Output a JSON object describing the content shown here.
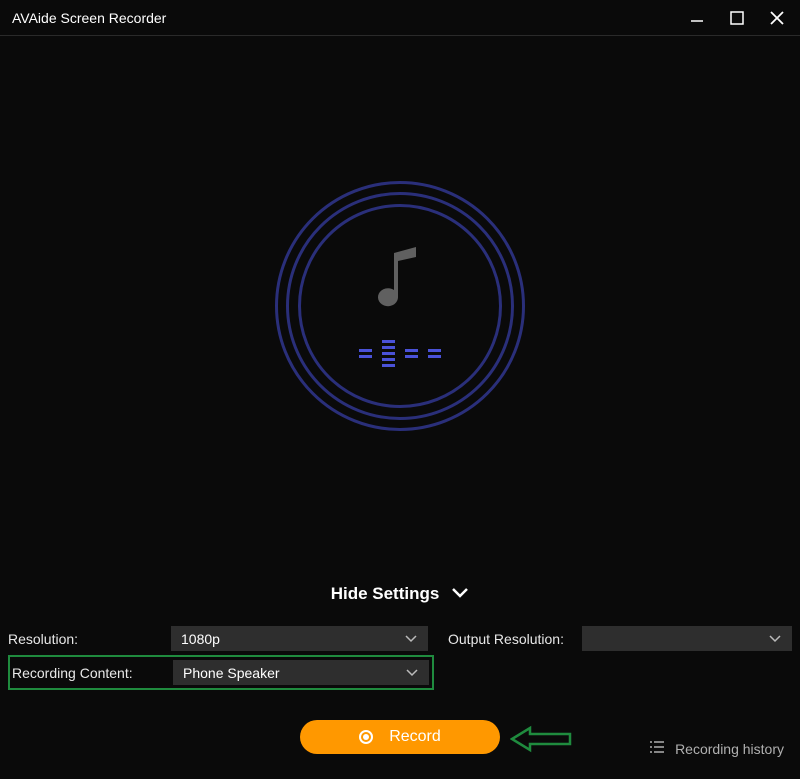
{
  "window": {
    "title": "AVAide Screen Recorder"
  },
  "hideSettings": {
    "label": "Hide Settings"
  },
  "settings": {
    "resolutionLabel": "Resolution:",
    "resolutionValue": "1080p",
    "outputResolutionLabel": "Output Resolution:",
    "outputResolutionValue": "",
    "recordingContentLabel": "Recording Content:",
    "recordingContentValue": "Phone Speaker"
  },
  "footer": {
    "recordLabel": "Record",
    "historyLabel": "Recording history"
  }
}
